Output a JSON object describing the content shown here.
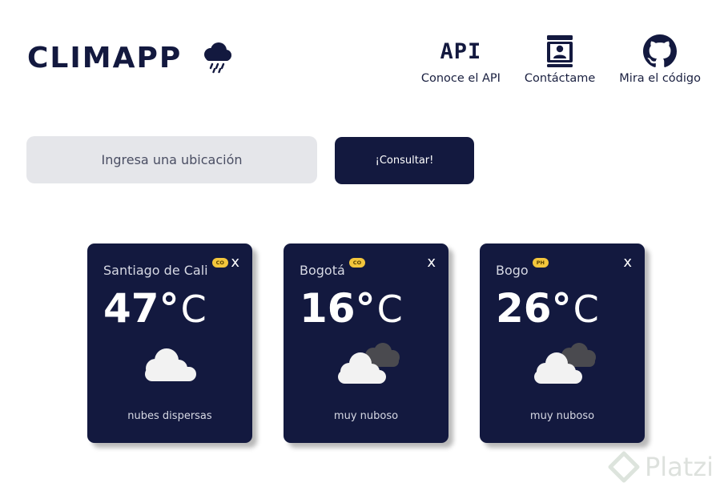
{
  "brand": {
    "title": "CLIMAPP",
    "icon": "rain-cloud-icon"
  },
  "nav": {
    "items": [
      {
        "label": "Conoce el API",
        "icon": "api-icon",
        "glyph": "API"
      },
      {
        "label": "Contáctame",
        "icon": "contact-book-icon"
      },
      {
        "label": "Mira el código",
        "icon": "github-icon"
      }
    ]
  },
  "search": {
    "placeholder": "Ingresa una ubicación",
    "value": "",
    "button_label": "¡Consultar!"
  },
  "cards": [
    {
      "city": "Santiago de Cali",
      "country": "CO",
      "temp": "47°",
      "unit": "C",
      "description": "nubes dispersas",
      "icon": "scattered-clouds-icon",
      "close": "x"
    },
    {
      "city": "Bogotá",
      "country": "CO",
      "temp": "16°",
      "unit": "C",
      "description": "muy nuboso",
      "icon": "broken-clouds-icon",
      "close": "x"
    },
    {
      "city": "Bogo",
      "country": "PH",
      "temp": "26°",
      "unit": "C",
      "description": "muy nuboso",
      "icon": "broken-clouds-icon",
      "close": "x"
    }
  ],
  "watermark": {
    "text": "Platzi"
  },
  "colors": {
    "primary": "#13193f",
    "input_bg": "#e5e6ea",
    "badge": "#f3c63c",
    "card_text": "#d7d9e4"
  }
}
